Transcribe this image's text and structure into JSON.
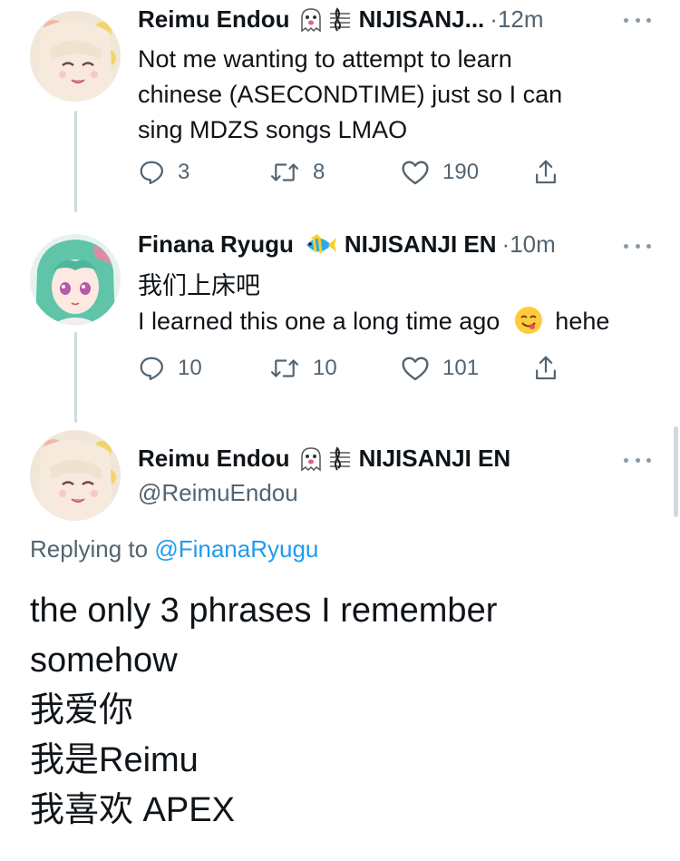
{
  "tweets": [
    {
      "name": "Reimu Endou",
      "affiliation": "NIJISANJ...",
      "time": "12m",
      "text": [
        "Not me wanting to attempt to learn",
        "chinese (ASECONDTIME) just so I can",
        "sing MDZS songs LMAO"
      ],
      "replies": "3",
      "retweets": "8",
      "likes": "190"
    },
    {
      "name": "Finana Ryugu",
      "affiliation": "NIJISANJI EN",
      "time": "10m",
      "text": [
        "我们上床吧",
        "I learned this one a long time ago",
        "hehe"
      ],
      "replies": "10",
      "retweets": "10",
      "likes": "101"
    }
  ],
  "main_tweet": {
    "name": "Reimu Endou",
    "affiliation": "NIJISANJI EN",
    "handle": "@ReimuEndou",
    "replying_prefix": "Replying to",
    "replying_to": "@FinanaRyugu",
    "text": [
      "the only 3 phrases I remember",
      "somehow",
      "我爱你",
      "我是Reimu",
      "我喜欢 APEX"
    ]
  },
  "icons": {
    "reply": "reply-icon",
    "retweet": "retweet-icon",
    "like": "heart-icon",
    "share": "share-icon",
    "more": "more-icon",
    "ghost": "ghost-emoji-icon",
    "music": "music-score-emoji-icon",
    "fish": "tropical-fish-emoji-icon",
    "smile": "yum-face-emoji-icon"
  },
  "colors": {
    "text": "#0f1419",
    "secondary": "#536471",
    "link": "#1d9bf0",
    "thread_line": "#cfd9de"
  }
}
